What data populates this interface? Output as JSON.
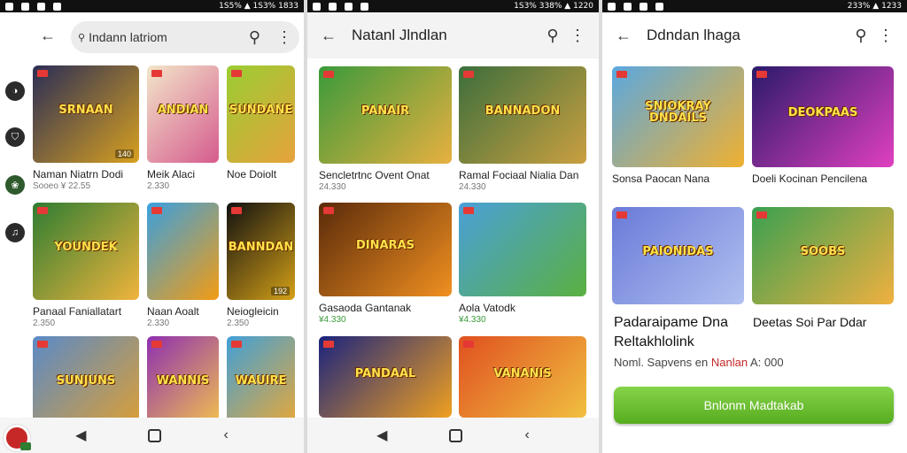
{
  "status": {
    "left_time": "",
    "s1": "1S5% ▲ 1S3%  1833",
    "s2": "1S3% 338% ▲ 1220",
    "s3": "233% ▲ 1233"
  },
  "screen1": {
    "search_text": "Indann latriom",
    "items": [
      {
        "label": "Naman Niatrn Dodi",
        "sub": "Sooeo ¥ 22.55",
        "art": "SRNAAN",
        "badge": "140",
        "colors": [
          "#2a2d56",
          "#d8a020"
        ]
      },
      {
        "label": "Meik Alaci",
        "sub": "2.330",
        "art": "ANDIAN",
        "badge": "",
        "colors": [
          "#f2e6c9",
          "#d65b8e"
        ]
      },
      {
        "label": "Noe Doiolt",
        "sub": "",
        "art": "SUNDANE",
        "badge": "",
        "colors": [
          "#9acd32",
          "#e6a23c"
        ]
      },
      {
        "label": "Panaal Faniallatart",
        "sub": "2.350",
        "art": "YOUNDEK",
        "badge": "",
        "colors": [
          "#2e7d32",
          "#f0b43c"
        ]
      },
      {
        "label": "Naan Aoalt",
        "sub": "2.330",
        "art": "",
        "badge": "",
        "colors": [
          "#39a0e0",
          "#f39c12"
        ]
      },
      {
        "label": "Neiogleicin",
        "sub": "2.350",
        "art": "BANNDAN",
        "badge": "192",
        "colors": [
          "#111111",
          "#d4a017"
        ]
      },
      {
        "label": "",
        "sub": "",
        "art": "SUNJUNS",
        "badge": "",
        "colors": [
          "#5a8ac8",
          "#e0a030"
        ]
      },
      {
        "label": "",
        "sub": "",
        "art": "WANNIS",
        "badge": "",
        "colors": [
          "#8e2fb0",
          "#f7c84a"
        ]
      },
      {
        "label": "",
        "sub": "",
        "art": "WAUIRE",
        "badge": "",
        "colors": [
          "#40a0d8",
          "#f0a830"
        ]
      }
    ]
  },
  "screen2": {
    "title": "Natanl Jlndlan",
    "items": [
      {
        "label": "Sencletrtnc Ovent Onat",
        "sub": "24.330",
        "art": "PANAIR",
        "badge": "",
        "colors": [
          "#3a9a3a",
          "#e8b040"
        ]
      },
      {
        "label": "Ramal Fociaal Nialia Dan",
        "sub": "24.330",
        "art": "BANNADON",
        "badge": "",
        "colors": [
          "#3c6e3c",
          "#caa040"
        ]
      },
      {
        "label": "Gasaoda Gantanak",
        "sub": "¥4.330",
        "art": "DINARAS",
        "badge": "",
        "colors": [
          "#5a2a0a",
          "#f09020"
        ]
      },
      {
        "label": "Aola Vatodk",
        "sub": "¥4.330",
        "art": "",
        "badge": "",
        "colors": [
          "#4aa0d8",
          "#5ab040"
        ]
      },
      {
        "label": "",
        "sub": "",
        "art": "PANDAAL",
        "badge": "",
        "colors": [
          "#1a237e",
          "#f0a020"
        ]
      },
      {
        "label": "",
        "sub": "",
        "art": "VANANIS",
        "badge": "",
        "colors": [
          "#e05020",
          "#f0c040"
        ]
      }
    ]
  },
  "screen3": {
    "title": "Ddndan lhaga",
    "items": [
      {
        "label": "Sonsa Paocan Nana",
        "art": "SNIOKRAY DNDAILS",
        "badge": "",
        "colors": [
          "#5aa8e0",
          "#f0b030"
        ]
      },
      {
        "label": "Doeli Kocinan Pencilena",
        "art": "DEOKPAAS",
        "badge": "",
        "colors": [
          "#2a1a6a",
          "#e040c0"
        ]
      },
      {
        "label": "",
        "art": "PAIONIDAS",
        "badge": "",
        "colors": [
          "#6a7ad8",
          "#b0c0f0"
        ]
      },
      {
        "label": "",
        "art": "SOOBS",
        "badge": "",
        "colors": [
          "#3aa050",
          "#f0b040"
        ]
      }
    ],
    "detail_left_title_1": "Padaraipame Dna",
    "detail_left_title_2": "Reltakhlolink",
    "detail_right_title": "Deetas Soi Par Ddar",
    "meta_prefix": "Noml. Sapvens en",
    "meta_highlight": "Nanlan",
    "meta_suffix": "A: 000",
    "button_label": "Bnlonm Madtakab"
  }
}
